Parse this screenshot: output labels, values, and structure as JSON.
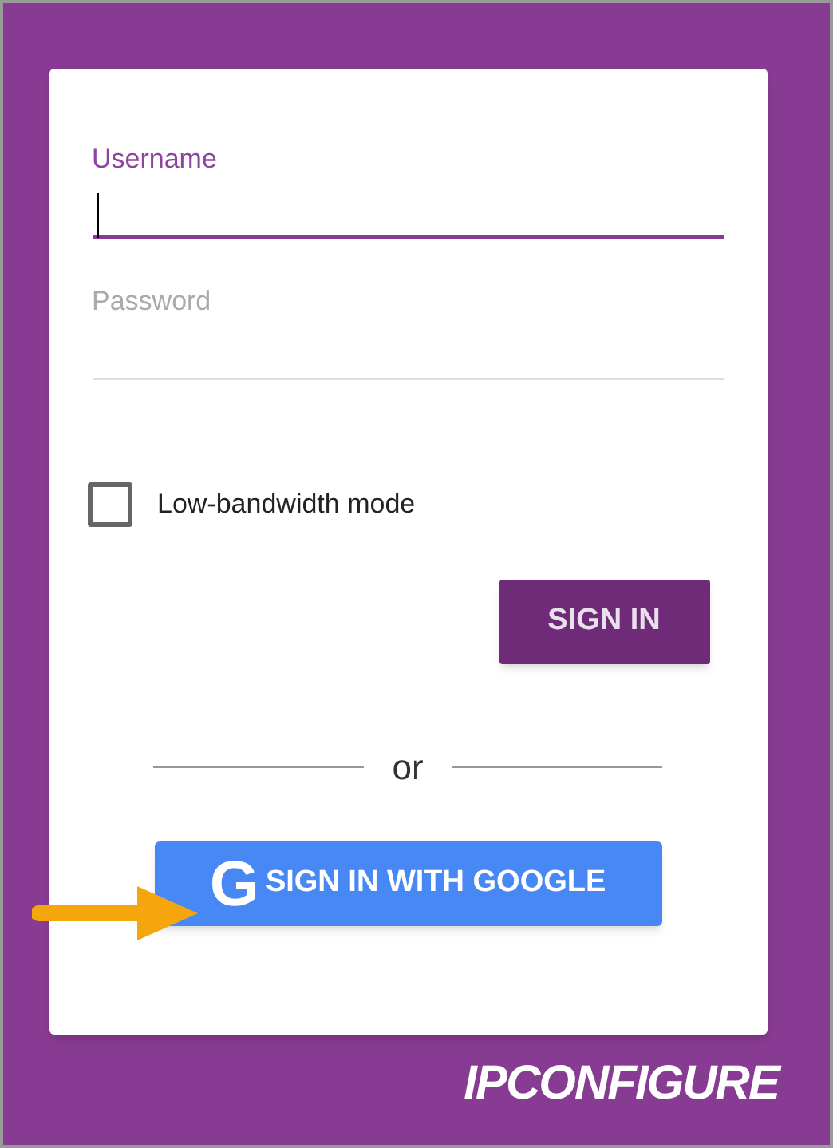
{
  "form": {
    "fields": [
      {
        "label": "Username",
        "focused": true
      },
      {
        "label": "Password",
        "focused": false
      }
    ],
    "checkbox": {
      "label": "Low-bandwidth mode",
      "checked": false
    },
    "sign_in_button": "SIGN IN",
    "divider": "or",
    "google_button": {
      "icon": "G",
      "label": "SIGN IN WITH GOOGLE"
    }
  },
  "logo": "IPCONFIGURE"
}
